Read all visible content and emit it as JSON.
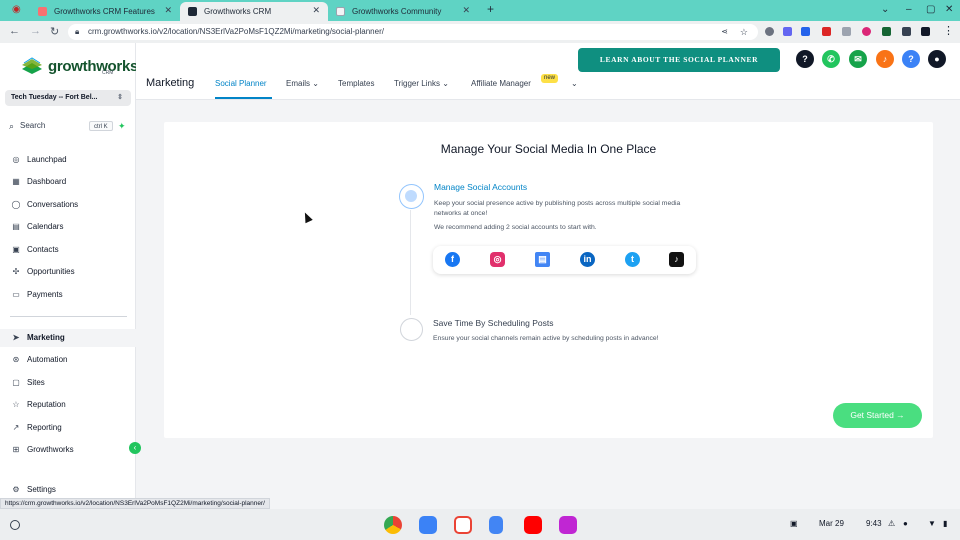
{
  "browser": {
    "tabs": [
      {
        "title": "Growthworks CRM Features",
        "active": false
      },
      {
        "title": "Growthworks CRM",
        "active": true
      },
      {
        "title": "Growthworks Community",
        "active": false
      }
    ],
    "url": "crm.growthworks.io/v2/location/NS3ErlVa2PoMsF1QZ2Mi/marketing/social-planner/",
    "status_url": "https://crm.growthworks.io/v2/location/NS3ErlVa2PoMsF1QZ2Mi/marketing/social-planner/"
  },
  "sidebar": {
    "logo_text": "growthworks",
    "logo_sub": "CRM",
    "account": "Tech Tuesday -- Fort Bel...",
    "search_label": "Search",
    "search_shortcut": "ctrl K",
    "items": [
      {
        "label": "Launchpad",
        "icon": "rocket-icon"
      },
      {
        "label": "Dashboard",
        "icon": "grid-icon"
      },
      {
        "label": "Conversations",
        "icon": "chat-icon"
      },
      {
        "label": "Calendars",
        "icon": "calendar-icon"
      },
      {
        "label": "Contacts",
        "icon": "contact-icon"
      },
      {
        "label": "Opportunities",
        "icon": "opportunity-icon"
      },
      {
        "label": "Payments",
        "icon": "payment-icon"
      },
      {
        "label": "Marketing",
        "icon": "send-icon",
        "active": true
      },
      {
        "label": "Automation",
        "icon": "automation-icon"
      },
      {
        "label": "Sites",
        "icon": "sites-icon"
      },
      {
        "label": "Reputation",
        "icon": "star-icon"
      },
      {
        "label": "Reporting",
        "icon": "chart-icon"
      },
      {
        "label": "Growthworks",
        "icon": "growthworks-icon"
      },
      {
        "label": "Settings",
        "icon": "gear-icon"
      }
    ]
  },
  "header": {
    "title": "Marketing",
    "tabs": [
      "Social Planner",
      "Emails",
      "Templates",
      "Trigger Links",
      "Affiliate Manager"
    ],
    "new_badge": "new",
    "learn_button": "LEARN ABOUT THE SOCIAL PLANNER"
  },
  "main": {
    "title": "Manage Your Social Media In One Place",
    "step1_title": "Manage Social Accounts",
    "step1_desc": "Keep your social presence active by publishing posts across multiple social media networks at once!",
    "step1_rec": "We recommend adding 2 social accounts to start with.",
    "socials": [
      "facebook",
      "instagram",
      "google-business",
      "linkedin",
      "twitter",
      "tiktok"
    ],
    "step2_title": "Save Time By Scheduling Posts",
    "step2_desc": "Ensure your social channels remain active by scheduling posts in advance!",
    "get_started": "Get Started →"
  },
  "taskbar": {
    "date": "Mar 29",
    "time": "9:43"
  },
  "colors": {
    "accent": "#0284c7",
    "brand_green": "#4ade80",
    "teal_button": "#0f8f80",
    "tabbar": "#5fd3c4"
  }
}
